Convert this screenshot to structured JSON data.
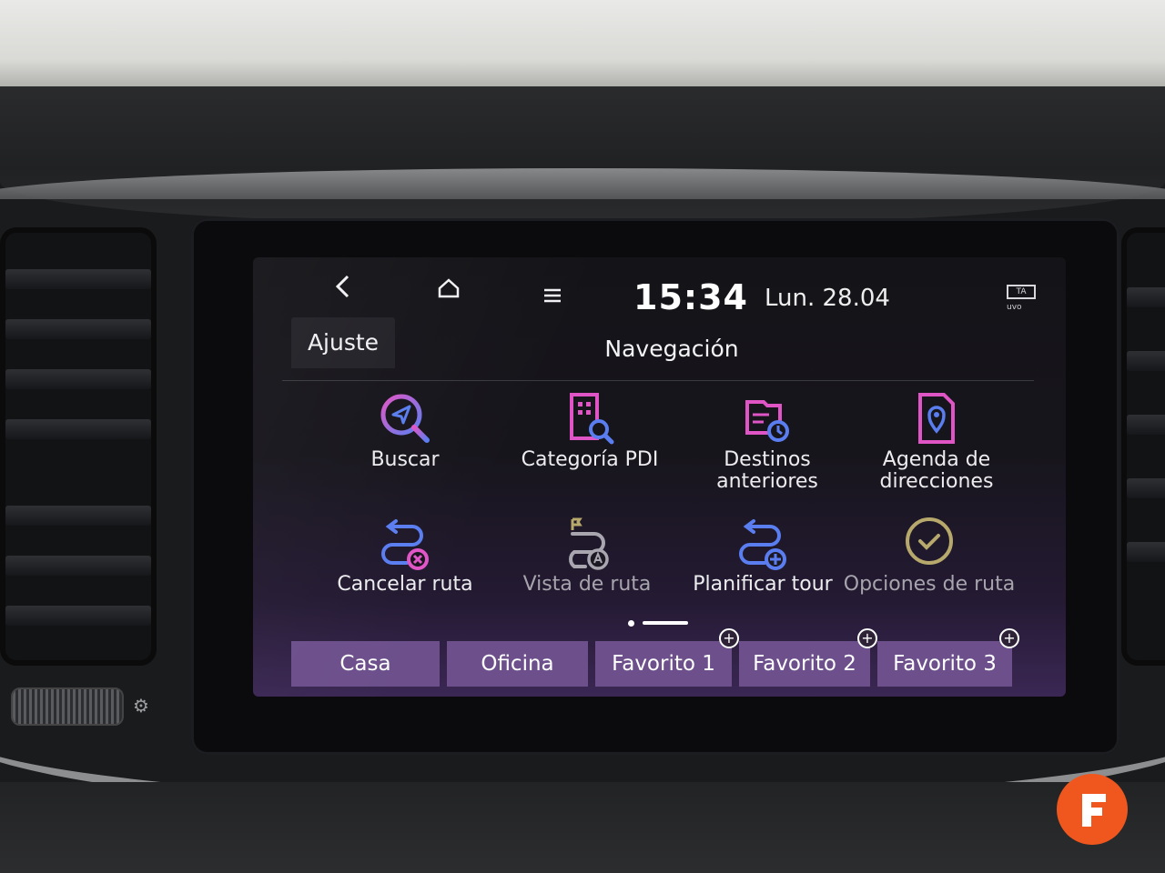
{
  "status_bar": {
    "back_icon": "chevron-left",
    "home_icon": "home",
    "menu_icon": "hamburger-menu",
    "time": "15:34",
    "date": "Lun. 28.04",
    "ta_badge": "TA",
    "uvo_label": "uvo"
  },
  "header": {
    "tab_label": "Ajuste",
    "title": "Navegación"
  },
  "menu": {
    "items": [
      {
        "label": "Buscar",
        "icon": "search-location"
      },
      {
        "label": "Categoría PDI",
        "icon": "poi-building-search"
      },
      {
        "label": "Destinos anteriores",
        "icon": "recent-destinations"
      },
      {
        "label": "Agenda de direcciones",
        "icon": "address-book-pin"
      },
      {
        "label": "Cancelar ruta",
        "icon": "route-cancel"
      },
      {
        "label": "Vista de ruta",
        "icon": "route-overview"
      },
      {
        "label": "Planificar tour",
        "icon": "route-add"
      },
      {
        "label": "Opciones de ruta",
        "icon": "check-circle"
      }
    ]
  },
  "pager": {
    "current_page": 1,
    "total_pages": 2
  },
  "favorites": {
    "items": [
      {
        "label": "Casa",
        "has_add": false
      },
      {
        "label": "Oficina",
        "has_add": false
      },
      {
        "label": "Favorito 1",
        "has_add": true
      },
      {
        "label": "Favorito 2",
        "has_add": true
      },
      {
        "label": "Favorito 3",
        "has_add": true
      }
    ]
  },
  "colors": {
    "accent_purple": "#6c4f8b",
    "icon_blue": "#5a7df0",
    "icon_pink": "#e055c6",
    "logo_orange": "#f0571f"
  }
}
